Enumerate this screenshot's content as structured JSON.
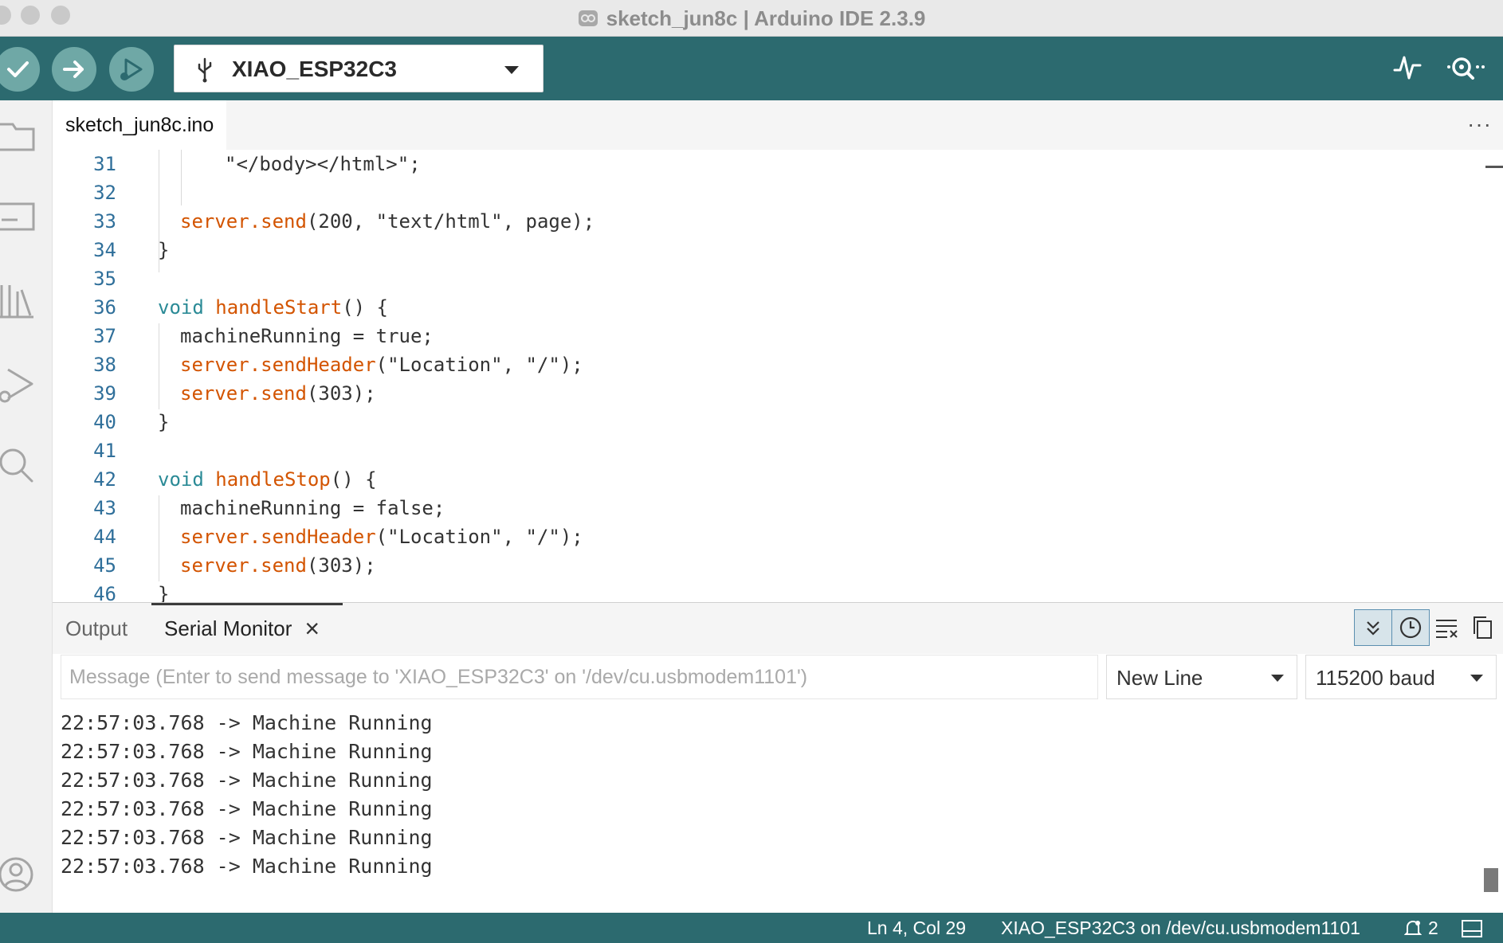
{
  "window": {
    "title": "sketch_jun8c | Arduino IDE 2.3.9"
  },
  "toolbar": {
    "board_name": "XIAO_ESP32C3",
    "buttons": {
      "verify": "check-icon",
      "upload": "arrow-right-icon",
      "debug": "debug-icon",
      "serial_plotter": "serial-plotter-icon",
      "serial_monitor": "serial-monitor-icon"
    }
  },
  "editor": {
    "tab_label": "sketch_jun8c.ino",
    "more": "···",
    "lines": [
      {
        "n": "31",
        "parts": [
          {
            "t": "\"</body></html>\";",
            "c": "plain"
          }
        ]
      },
      {
        "n": "32",
        "parts": []
      },
      {
        "n": "33",
        "parts": [
          {
            "t": "server.send",
            "c": "func"
          },
          {
            "t": "(200, \"text/html\", page);",
            "c": "plain"
          }
        ]
      },
      {
        "n": "34",
        "parts": [
          {
            "t": "}",
            "c": "plain"
          }
        ]
      },
      {
        "n": "35",
        "parts": []
      },
      {
        "n": "36",
        "parts": [
          {
            "t": "void ",
            "c": "type"
          },
          {
            "t": "handleStart",
            "c": "func"
          },
          {
            "t": "() {",
            "c": "plain"
          }
        ]
      },
      {
        "n": "37",
        "parts": [
          {
            "t": "machineRunning = true;",
            "c": "plain"
          }
        ]
      },
      {
        "n": "38",
        "parts": [
          {
            "t": "server.sendHeader",
            "c": "func"
          },
          {
            "t": "(\"Location\", \"/\");",
            "c": "plain"
          }
        ]
      },
      {
        "n": "39",
        "parts": [
          {
            "t": "server.send",
            "c": "func"
          },
          {
            "t": "(303);",
            "c": "plain"
          }
        ]
      },
      {
        "n": "40",
        "parts": [
          {
            "t": "}",
            "c": "plain"
          }
        ]
      },
      {
        "n": "41",
        "parts": []
      },
      {
        "n": "42",
        "parts": [
          {
            "t": "void ",
            "c": "type"
          },
          {
            "t": "handleStop",
            "c": "func"
          },
          {
            "t": "() {",
            "c": "plain"
          }
        ]
      },
      {
        "n": "43",
        "parts": [
          {
            "t": "machineRunning = false;",
            "c": "plain"
          }
        ]
      },
      {
        "n": "44",
        "parts": [
          {
            "t": "server.sendHeader",
            "c": "func"
          },
          {
            "t": "(\"Location\", \"/\");",
            "c": "plain"
          }
        ]
      },
      {
        "n": "45",
        "parts": [
          {
            "t": "server.send",
            "c": "func"
          },
          {
            "t": "(303);",
            "c": "plain"
          }
        ]
      },
      {
        "n": "46",
        "parts": [
          {
            "t": "}",
            "c": "plain"
          }
        ]
      }
    ]
  },
  "panel": {
    "tabs": {
      "output": "Output",
      "serial_monitor": "Serial Monitor",
      "close": "×"
    },
    "message_placeholder": "Message (Enter to send message to 'XIAO_ESP32C3' on '/dev/cu.usbmodem1101')",
    "line_ending": "New Line",
    "baud": "115200 baud",
    "output_lines": [
      "22:57:03.768 -> Machine Running",
      "22:57:03.768 -> Machine Running",
      "22:57:03.768 -> Machine Running",
      "22:57:03.768 -> Machine Running",
      "22:57:03.768 -> Machine Running",
      "22:57:03.768 -> Machine Running"
    ]
  },
  "status": {
    "cursor": "Ln 4, Col 29",
    "board_port": "XIAO_ESP32C3 on /dev/cu.usbmodem1101",
    "notifications": "2"
  },
  "colors": {
    "toolbar": "#2c6a6f",
    "toolbar_button": "#6fa8a6",
    "keyword": "#2a8a96",
    "function": "#d35400",
    "line_number": "#2f6f9a"
  }
}
